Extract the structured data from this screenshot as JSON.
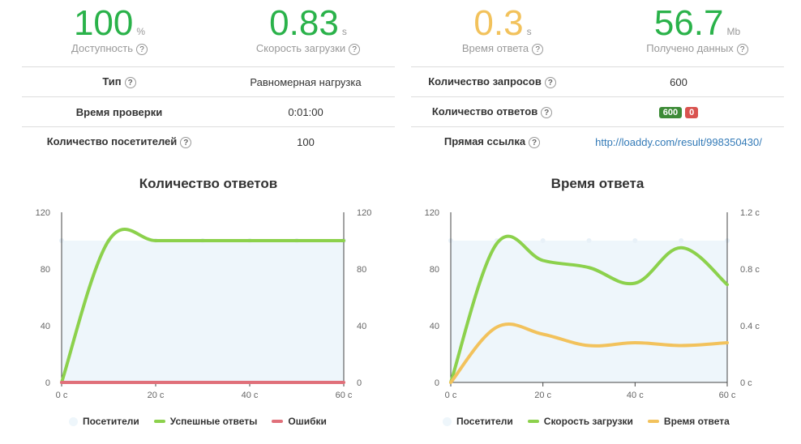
{
  "stats": [
    {
      "value": "100",
      "unit": "%",
      "label": "Доступность",
      "color": "#2ab24a"
    },
    {
      "value": "0.83",
      "unit": "s",
      "label": "Скорость загрузки",
      "color": "#2ab24a"
    },
    {
      "value": "0.3",
      "unit": "s",
      "label": "Время ответа",
      "color": "#f2c25c"
    },
    {
      "value": "56.7",
      "unit": "Mb",
      "label": "Получено данных",
      "color": "#2ab24a"
    }
  ],
  "help_glyph": "?",
  "left_table": [
    {
      "key": "Тип",
      "value": "Равномерная нагрузка"
    },
    {
      "key": "Время проверки",
      "value": "0:01:00"
    },
    {
      "key": "Количество посетителей",
      "value": "100"
    }
  ],
  "right_table": {
    "requests_key": "Количество запросов",
    "requests_value": "600",
    "responses_key": "Количество ответов",
    "responses_ok": "600",
    "responses_err": "0",
    "link_key": "Прямая ссылка",
    "link_value": "http://loaddy.com/result/998350430/"
  },
  "chart_data": [
    {
      "type": "line",
      "title": "Количество ответов",
      "x": [
        0,
        10,
        20,
        30,
        40,
        50,
        60
      ],
      "x_tick_labels": [
        "0 с",
        "20 с",
        "40 с",
        "60 с"
      ],
      "x_tick_values": [
        0,
        20,
        40,
        60
      ],
      "y_left_ticks": [
        "0",
        "40",
        "80",
        "120"
      ],
      "y_right_ticks": [
        "0",
        "40",
        "80",
        "120"
      ],
      "ylim": [
        0,
        120
      ],
      "y2lim": [
        0,
        120
      ],
      "series": [
        {
          "name": "Посетители",
          "kind": "area",
          "color": "#eef6fb",
          "values": [
            100,
            100,
            100,
            100,
            100,
            100,
            100
          ]
        },
        {
          "name": "Успешные ответы",
          "kind": "line",
          "color": "#8cd14c",
          "values": [
            0,
            100,
            100,
            100,
            100,
            100,
            100
          ]
        },
        {
          "name": "Ошибки",
          "kind": "line",
          "color": "#e0707a",
          "values": [
            0,
            0,
            0,
            0,
            0,
            0,
            0
          ]
        }
      ],
      "legend": [
        {
          "name": "Посетители",
          "color": "#eef6fb",
          "shape": "dot"
        },
        {
          "name": "Успешные ответы",
          "color": "#8cd14c",
          "shape": "line"
        },
        {
          "name": "Ошибки",
          "color": "#e0707a",
          "shape": "line"
        }
      ]
    },
    {
      "type": "line",
      "title": "Время ответа",
      "x": [
        0,
        10,
        20,
        30,
        40,
        50,
        60
      ],
      "x_tick_labels": [
        "0 с",
        "20 с",
        "40 с",
        "60 с"
      ],
      "x_tick_values": [
        0,
        20,
        40,
        60
      ],
      "y_left_ticks": [
        "0",
        "40",
        "80",
        "120"
      ],
      "y_right_ticks": [
        "0 с",
        "0.4 с",
        "0.8 с",
        "1.2 с"
      ],
      "ylim": [
        0,
        120
      ],
      "y2lim": [
        0,
        1.2
      ],
      "series": [
        {
          "name": "Посетители",
          "kind": "area",
          "axis": "left",
          "color": "#eef6fb",
          "values": [
            100,
            100,
            100,
            100,
            100,
            100,
            100
          ]
        },
        {
          "name": "Скорость загрузки",
          "kind": "line",
          "axis": "right",
          "color": "#8cd14c",
          "values": [
            0,
            0.98,
            0.86,
            0.81,
            0.7,
            0.95,
            0.69
          ]
        },
        {
          "name": "Время ответа",
          "kind": "line",
          "axis": "right",
          "color": "#f2c25c",
          "values": [
            0,
            0.39,
            0.34,
            0.26,
            0.28,
            0.26,
            0.28
          ]
        }
      ],
      "legend": [
        {
          "name": "Посетители",
          "color": "#eef6fb",
          "shape": "dot"
        },
        {
          "name": "Скорость загрузки",
          "color": "#8cd14c",
          "shape": "line"
        },
        {
          "name": "Время ответа",
          "color": "#f2c25c",
          "shape": "line"
        }
      ]
    }
  ]
}
